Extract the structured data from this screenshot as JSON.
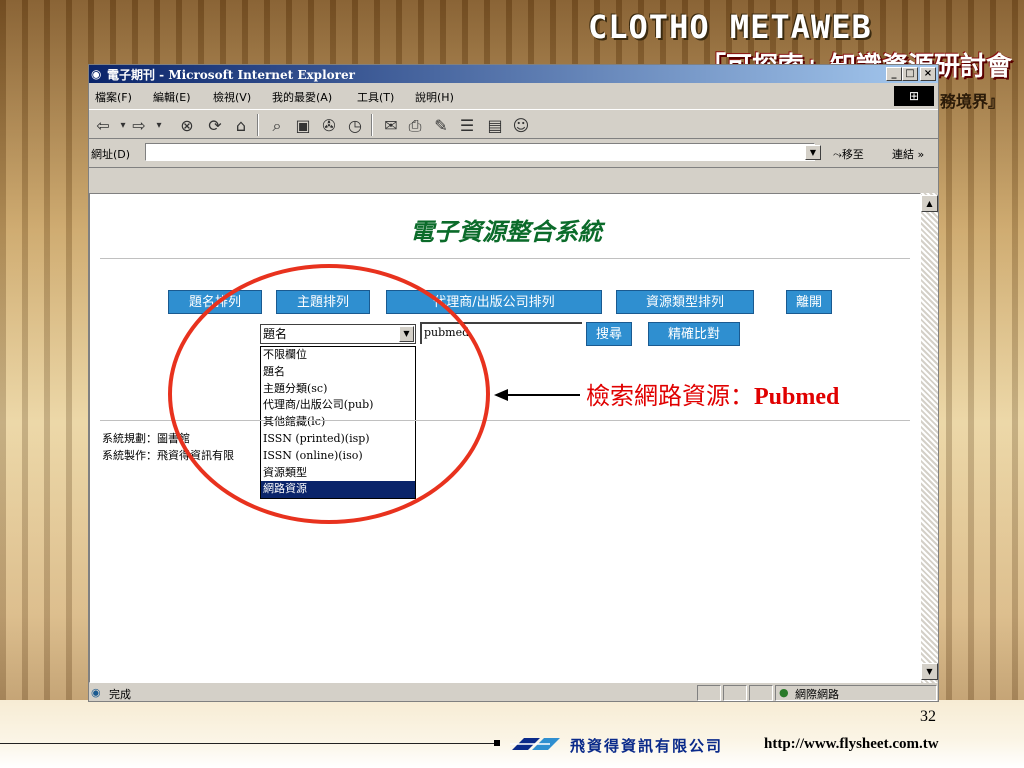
{
  "banner": {
    "title": "CLOTHO METAWEB",
    "subtitle": "「可探索」知識資源研討會",
    "subtitle2": "務境界』"
  },
  "window": {
    "title": "電子期刊 - Microsoft Internet Explorer",
    "minimize": "_",
    "maximize": "□",
    "close": "×"
  },
  "menu": {
    "items": [
      "檔案(F)",
      "編輯(E)",
      "檢視(V)",
      "我的最愛(A)",
      "工具(T)",
      "說明(H)"
    ]
  },
  "toolbar": {
    "icons": [
      "back-icon",
      "forward-icon",
      "stop-icon",
      "refresh-icon",
      "home-icon",
      "search-icon",
      "favorites-icon",
      "history-icon",
      "media-icon",
      "mail-icon",
      "print-icon",
      "edit-icon",
      "discuss-icon",
      "messenger-icon"
    ]
  },
  "address": {
    "label": "網址(D)",
    "value": "",
    "go_label": "移至",
    "links_label": "連結 »"
  },
  "page": {
    "title": "電子資源整合系統",
    "nav_buttons": [
      "題名排列",
      "主題排列",
      "代理商/出版公司排列",
      "資源類型排列",
      "離開"
    ],
    "field_select_value": "題名",
    "search_value": "pubmed",
    "search_button": "搜尋",
    "exact_button": "精確比對",
    "dropdown_options": [
      "不限欄位",
      "題名",
      "主題分類(sc)",
      "代理商/出版公司(pub)",
      "其他館藏(lc)",
      "ISSN (printed)(isp)",
      "ISSN (online)(iso)",
      "資源類型",
      "網路資源"
    ],
    "selected_option": "網路資源",
    "footer_line1": "系統規劃：圖書館",
    "footer_line2": "系統製作：飛資得資訊有限"
  },
  "status": {
    "text": "完成",
    "zone": "網際網路"
  },
  "annotation": {
    "prefix": "檢索網路資源：",
    "term": "Pubmed",
    "color": "#e00000"
  },
  "slide": {
    "number": "32",
    "company": "飛資得資訊有限公司",
    "url": "http://www.flysheet.com.tw"
  }
}
